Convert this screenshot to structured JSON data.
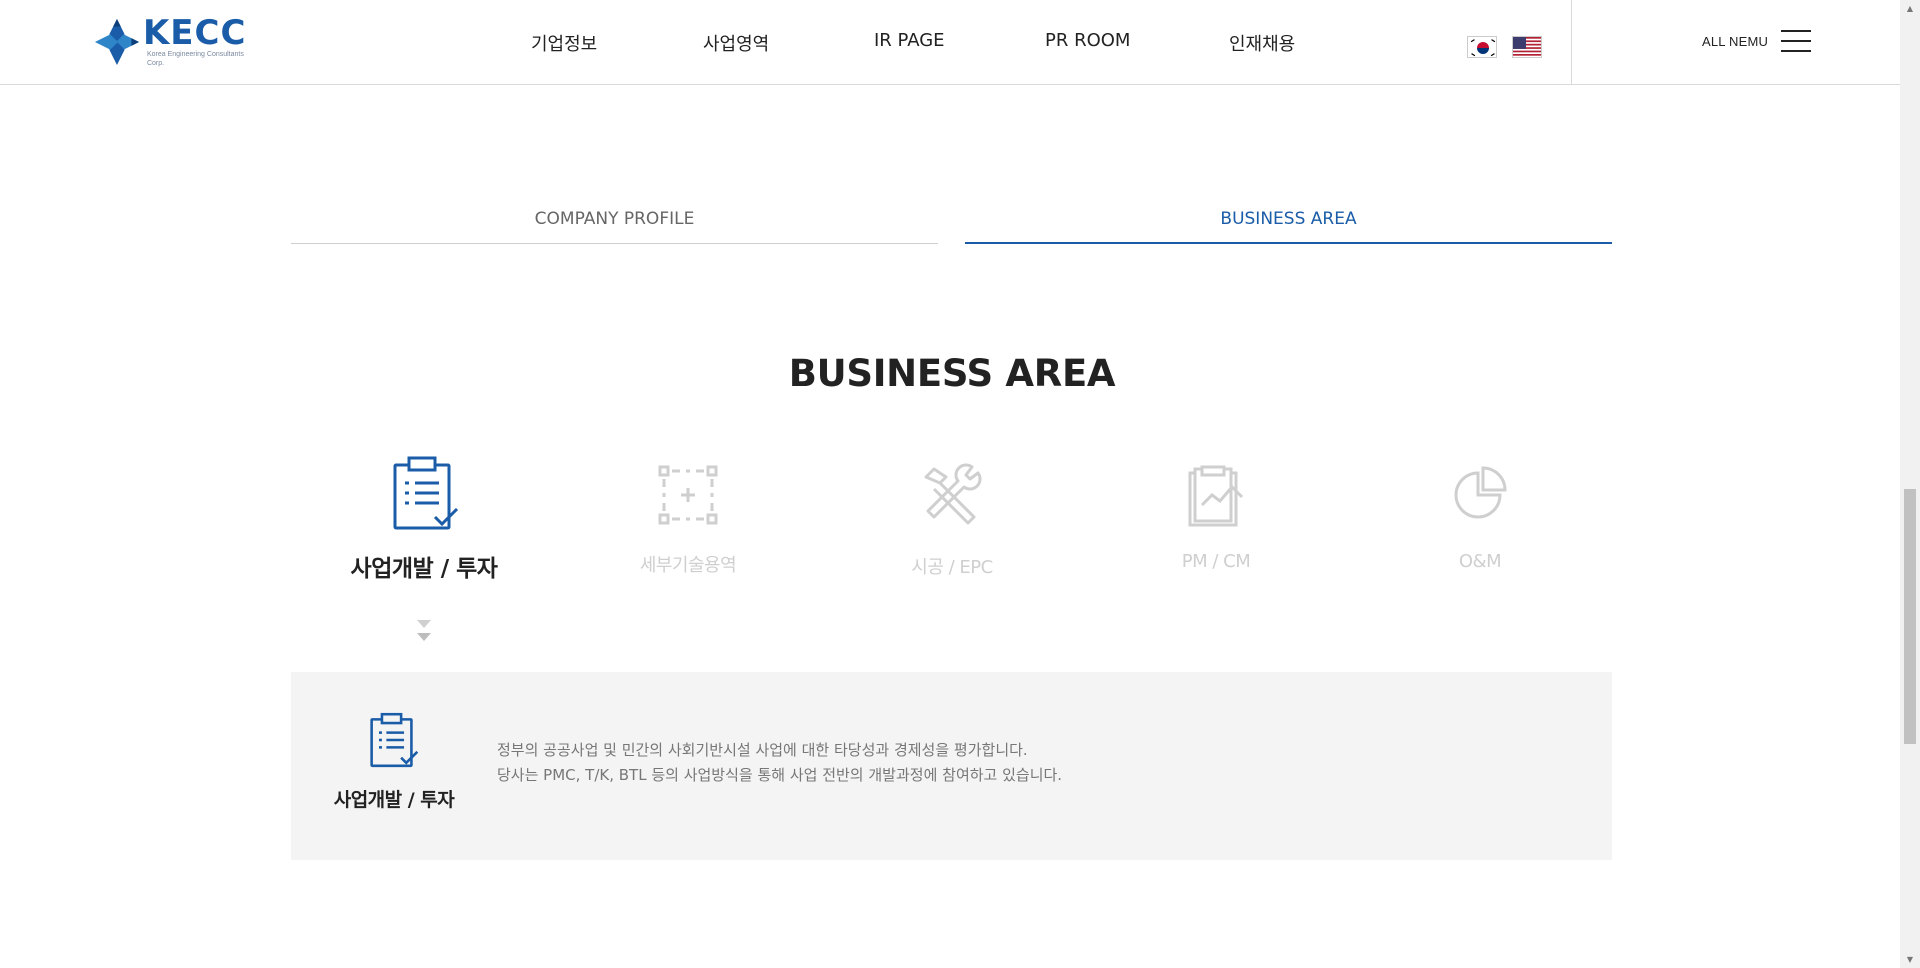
{
  "header": {
    "logo_text": "KECC",
    "logo_subtext": "Korea Engineering Consultants Corp.",
    "nav": [
      {
        "label": "기업정보"
      },
      {
        "label": "사업영역"
      },
      {
        "label": "IR PAGE"
      },
      {
        "label": "PR ROOM"
      },
      {
        "label": "인재채용"
      }
    ],
    "languages": [
      "korean-flag-icon",
      "us-flag-icon"
    ],
    "all_menu_label": "ALL NEMU",
    "all_menu_icon": "hamburger-icon"
  },
  "tabs": [
    {
      "label": "COMPANY PROFILE",
      "active": false
    },
    {
      "label": "BUSINESS AREA",
      "active": true
    }
  ],
  "section_title": "BUSINESS AREA",
  "business_items": [
    {
      "label": "사업개발 / 투자",
      "icon": "clipboard-checklist-icon",
      "active": true
    },
    {
      "label": "세부기술용역",
      "icon": "frame-nodes-icon",
      "active": false
    },
    {
      "label": "시공 / EPC",
      "icon": "tools-wrench-hammer-icon",
      "active": false
    },
    {
      "label": "PM / CM",
      "icon": "clipboard-chart-icon",
      "active": false
    },
    {
      "label": "O&M",
      "icon": "pie-chart-icon",
      "active": false
    }
  ],
  "detail": {
    "title": "사업개발 / 투자",
    "icon": "clipboard-checklist-icon",
    "description_lines": [
      "정부의 공공사업 및 민간의 사회기반시설 사업에 대한 타당성과 경제성을 평가합니다.",
      "당사는 PMC, T/K, BTL 등의 사업방식을 통해 사업 전반의 개발과정에 참여하고 있습니다."
    ]
  },
  "colors": {
    "brand_blue": "#1a5ca8",
    "inactive_gray": "#cfcfcf",
    "panel_bg": "#f4f4f4"
  }
}
